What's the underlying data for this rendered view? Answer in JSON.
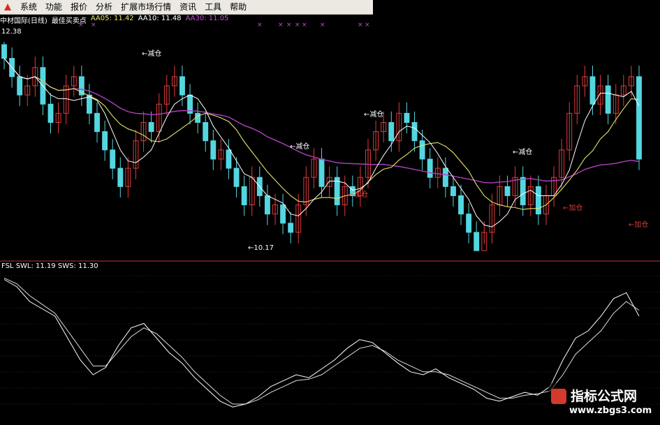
{
  "menu": [
    "系统",
    "功能",
    "报价",
    "分析",
    "扩展市场行情",
    "资讯",
    "工具",
    "帮助"
  ],
  "header": {
    "stock": "中材国际(日线)",
    "indicator": "最佳买卖点",
    "aa05": "AA05: 11.42",
    "aa10": "AA10: 11.48",
    "aa30": "AA30: 11.05"
  },
  "labels": {
    "high_price": "12.38",
    "low_price": "←10.17",
    "reduce": "←减仓",
    "add": "←加仓"
  },
  "sub_header": {
    "name": "FSL",
    "swl": "SWL: 11.19",
    "sws": "SWS: 11.30"
  },
  "watermark": {
    "title": "指标公式网",
    "url": "www.zbgs3.com"
  },
  "colors": {
    "up": "#e23b3b",
    "down": "#54d6e0",
    "ma5": "#ffffff",
    "ma10": "#e8e36a",
    "ma30": "#b040c0",
    "fsl": "#dddddd"
  },
  "chart_data": [
    {
      "type": "candlestick",
      "title": "中材国际(日线) 最佳买卖点",
      "series": [
        {
          "name": "AA05",
          "last": 11.42
        },
        {
          "name": "AA10",
          "last": 11.48
        },
        {
          "name": "AA30",
          "last": 11.05
        }
      ],
      "price_max": 12.38,
      "price_min": 10.17,
      "annotations": {
        "high": "12.38",
        "low": "←10.17",
        "reduce_position": [
          "←减仓",
          "←减仓",
          "←减仓",
          "←减仓"
        ],
        "add_position": [
          "←加仓",
          "←加仓",
          "←加仓"
        ]
      },
      "ohlc_close": [
        12.2,
        12.0,
        11.8,
        11.9,
        12.1,
        11.7,
        11.5,
        11.6,
        11.9,
        12.0,
        11.8,
        11.6,
        11.4,
        11.2,
        11.0,
        10.8,
        11.0,
        11.3,
        11.5,
        11.4,
        11.7,
        11.9,
        12.0,
        11.8,
        11.6,
        11.5,
        11.3,
        11.1,
        11.2,
        11.0,
        10.8,
        10.6,
        10.9,
        10.7,
        10.5,
        10.6,
        10.4,
        10.3,
        10.6,
        10.9,
        11.1,
        10.8,
        10.9,
        10.6,
        10.8,
        10.7,
        10.9,
        11.2,
        11.4,
        11.5,
        11.3,
        11.6,
        11.5,
        11.3,
        11.1,
        10.9,
        11.0,
        10.8,
        10.7,
        10.5,
        10.3,
        10.1,
        10.3,
        10.6,
        10.8,
        10.7,
        10.9,
        10.6,
        10.8,
        10.5,
        10.7,
        10.9,
        11.2,
        11.6,
        11.9,
        12.0,
        11.7,
        11.9,
        11.6,
        11.8,
        11.9,
        12.0,
        11.1
      ]
    },
    {
      "type": "line",
      "title": "FSL",
      "series": [
        {
          "name": "SWL",
          "last": 11.19
        },
        {
          "name": "SWS",
          "last": 11.3
        }
      ],
      "x": [
        0,
        2,
        4,
        6,
        8,
        10,
        12,
        14,
        16,
        18,
        20,
        22,
        24,
        26,
        28,
        30,
        32,
        34,
        36,
        38,
        40,
        42,
        44,
        46,
        48,
        50,
        52,
        54,
        56,
        58,
        60,
        62,
        64,
        66,
        68,
        70,
        72,
        74,
        76,
        78,
        80,
        82,
        84,
        86,
        88,
        90,
        92,
        94,
        96,
        98,
        100
      ],
      "sws": [
        95,
        90,
        80,
        75,
        70,
        55,
        40,
        30,
        35,
        50,
        62,
        65,
        55,
        45,
        38,
        28,
        20,
        12,
        8,
        10,
        15,
        22,
        26,
        30,
        28,
        34,
        40,
        48,
        54,
        52,
        45,
        38,
        32,
        30,
        34,
        28,
        24,
        20,
        14,
        12,
        15,
        18,
        16,
        22,
        40,
        55,
        60,
        70,
        82,
        86,
        70
      ],
      "swl": [
        96,
        92,
        84,
        78,
        72,
        60,
        48,
        36,
        36,
        46,
        56,
        62,
        58,
        50,
        42,
        32,
        24,
        16,
        10,
        10,
        13,
        18,
        22,
        26,
        27,
        30,
        36,
        42,
        48,
        50,
        46,
        40,
        36,
        32,
        32,
        30,
        26,
        22,
        18,
        14,
        14,
        16,
        17,
        19,
        30,
        44,
        52,
        60,
        72,
        80,
        74
      ]
    }
  ]
}
